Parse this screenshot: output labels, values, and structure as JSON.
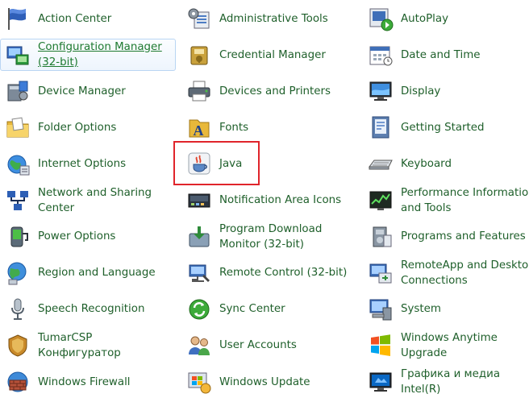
{
  "control_panel": {
    "columns": [
      [
        {
          "label": "Action Center",
          "icon": "flag-icon"
        },
        {
          "label": "Configuration Manager (32-bit)",
          "icon": "configuration-manager-icon",
          "state": "hover"
        },
        {
          "label": "Device Manager",
          "icon": "device-manager-icon"
        },
        {
          "label": "Folder Options",
          "icon": "folder-options-icon"
        },
        {
          "label": "Internet Options",
          "icon": "internet-options-icon"
        },
        {
          "label": "Network and Sharing Center",
          "icon": "network-icon"
        },
        {
          "label": "Power Options",
          "icon": "power-options-icon"
        },
        {
          "label": "Region and Language",
          "icon": "region-language-icon"
        },
        {
          "label": "Speech Recognition",
          "icon": "microphone-icon"
        },
        {
          "label": "TumarCSP Конфигуратор",
          "icon": "tumarcsp-icon"
        },
        {
          "label": "Windows Firewall",
          "icon": "firewall-icon"
        }
      ],
      [
        {
          "label": "Administrative Tools",
          "icon": "administrative-tools-icon"
        },
        {
          "label": "Credential Manager",
          "icon": "credential-manager-icon"
        },
        {
          "label": "Devices and Printers",
          "icon": "printer-icon"
        },
        {
          "label": "Fonts",
          "icon": "fonts-icon"
        },
        {
          "label": "Java",
          "icon": "java-icon",
          "highlighted": true
        },
        {
          "label": "Notification Area Icons",
          "icon": "notification-area-icon"
        },
        {
          "label": "Program Download Monitor (32-bit)",
          "icon": "program-download-icon"
        },
        {
          "label": "Remote Control (32-bit)",
          "icon": "remote-control-icon"
        },
        {
          "label": "Sync Center",
          "icon": "sync-center-icon"
        },
        {
          "label": "User Accounts",
          "icon": "user-accounts-icon"
        },
        {
          "label": "Windows Update",
          "icon": "windows-update-icon"
        }
      ],
      [
        {
          "label": "AutoPlay",
          "icon": "autoplay-icon"
        },
        {
          "label": "Date and Time",
          "icon": "calendar-icon"
        },
        {
          "label": "Display",
          "icon": "display-icon"
        },
        {
          "label": "Getting Started",
          "icon": "getting-started-icon"
        },
        {
          "label": "Keyboard",
          "icon": "keyboard-icon"
        },
        {
          "label": "Performance Information and Tools",
          "icon": "performance-icon"
        },
        {
          "label": "Programs and Features",
          "icon": "programs-features-icon"
        },
        {
          "label": "RemoteApp and Desktop Connections",
          "icon": "remoteapp-icon"
        },
        {
          "label": "System",
          "icon": "system-icon"
        },
        {
          "label": "Windows Anytime Upgrade",
          "icon": "anytime-upgrade-icon"
        },
        {
          "label": "Графика и медиа Intel(R)",
          "icon": "intel-graphics-icon"
        }
      ]
    ],
    "colors": {
      "link_text": "#1e5f2a",
      "hover_border": "#b9d5f3",
      "highlight_border": "#e0252b"
    }
  }
}
